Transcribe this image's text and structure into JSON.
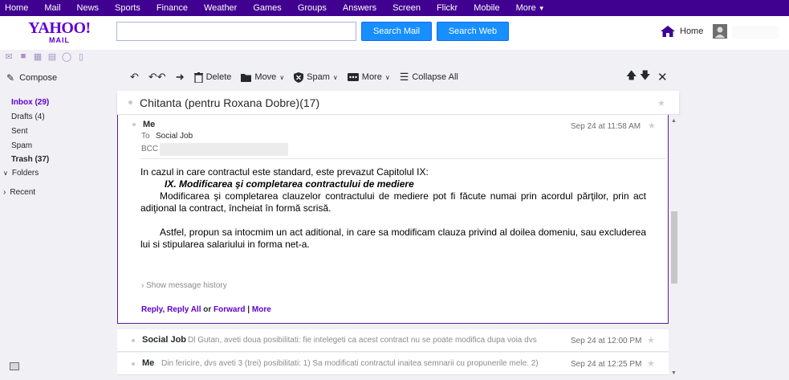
{
  "topnav": {
    "items": [
      "Home",
      "Mail",
      "News",
      "Sports",
      "Finance",
      "Weather",
      "Games",
      "Groups",
      "Answers",
      "Screen",
      "Flickr",
      "Mobile",
      "More"
    ]
  },
  "header": {
    "logo_line1": "YAHOO!",
    "logo_line2": "MAIL",
    "search_placeholder": "",
    "search_mail_label": "Search Mail",
    "search_web_label": "Search Web",
    "home_label": "Home"
  },
  "sidebar": {
    "compose_label": "Compose",
    "folders": [
      {
        "label": "Inbox (29)"
      },
      {
        "label": "Drafts (4)"
      },
      {
        "label": "Sent"
      },
      {
        "label": "Spam"
      },
      {
        "label": "Trash (37)"
      }
    ],
    "folders_toggle": "Folders",
    "recent_toggle": "Recent"
  },
  "toolbar": {
    "delete_label": "Delete",
    "move_label": "Move",
    "spam_label": "Spam",
    "more_label": "More",
    "collapse_label": "Collapse All"
  },
  "conversation": {
    "subject": "Chitanta (pentru Roxana Dobre)(17)"
  },
  "open_message": {
    "from": "Me",
    "to_label": "To",
    "to_value": "Social Job",
    "bcc_label": "BCC",
    "date": "Sep 24 at 11:58 AM",
    "body_line1": "In cazul in care contractul este standard, este prevazut Capitolul IX:",
    "body_heading": "IX. Modificarea şi completarea contractului de mediere",
    "body_para1": "Modificarea şi completarea clauzelor contractului de mediere pot fi făcute numai prin acordul părţilor, prin act adiţional la contract, încheiat în formă scrisă.",
    "body_para2": "Astfel, propun sa intocmim un act aditional, in care sa modificam clauza privind al doilea domeniu, sau excluderea lui si stipularea salariului in forma net-a.",
    "history_label": "Show message history",
    "reply_label": "Reply",
    "reply_all_label": "Reply All",
    "or_text": "or",
    "forward_label": "Forward",
    "more_label": "More"
  },
  "messages": [
    {
      "from": "Social Job",
      "snippet": "Dl Gutan, aveti doua posibilitati: fie intelegeti ca acest contract nu se poate modifica dupa voia dvs",
      "date": "Sep 24 at 12:00 PM"
    },
    {
      "from": "Me",
      "snippet": "Din fericire, dvs aveti 3 (trei) posibilitati: 1) Sa modificati contractul inaitea semnarii cu propunerile mele. 2)",
      "date": "Sep 24 at 12:25 PM"
    }
  ],
  "colors": {
    "brand_purple": "#400090",
    "accent_purple": "#6001d2",
    "button_blue": "#188fff"
  }
}
